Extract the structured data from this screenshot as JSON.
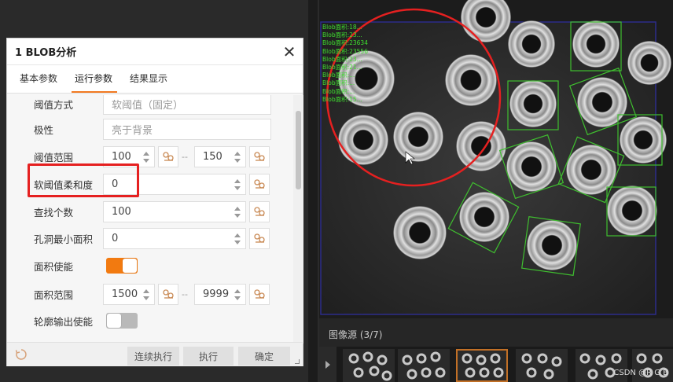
{
  "dialog": {
    "title": "1 BLOB分析",
    "tabs": [
      "基本参数",
      "运行参数",
      "结果显示"
    ],
    "active_tab": 1
  },
  "params": {
    "threshold_mode": {
      "label": "阈值方式",
      "value": "软阈值（固定）"
    },
    "polarity": {
      "label": "极性",
      "value": "亮于背景"
    },
    "threshold_range": {
      "label": "阈值范围",
      "min": "100",
      "max": "150"
    },
    "soft_threshold_softness": {
      "label": "软阈值柔和度",
      "value": "0"
    },
    "find_count": {
      "label": "查找个数",
      "value": "100"
    },
    "min_hole_area": {
      "label": "孔洞最小面积",
      "value": "0"
    },
    "area_enable": {
      "label": "面积使能",
      "on": true
    },
    "area_range": {
      "label": "面积范围",
      "min": "1500",
      "max": "9999"
    },
    "contour_output_enable": {
      "label": "轮廓输出使能",
      "on": false
    },
    "range_separator": "--"
  },
  "footer": {
    "continuous_run": "连续执行",
    "run": "执行",
    "confirm": "确定"
  },
  "image_panel": {
    "source_label": "图像源 (3/7)",
    "blob_labels": [
      "Blob面积:18...",
      "Blob面积:23...",
      "Blob面积:23634",
      "Blob面积:23556",
      "Blob面积:23...",
      "Blob面积:21...",
      "Blob面积:...",
      "Blob面积:...",
      "Blob面积:...",
      "Blob面积:15..."
    ],
    "watermark": "CSDN @R G B"
  },
  "colors": {
    "accent": "#f27a10",
    "annotation_red": "#e52020",
    "blob_green": "#3fbf2f"
  }
}
